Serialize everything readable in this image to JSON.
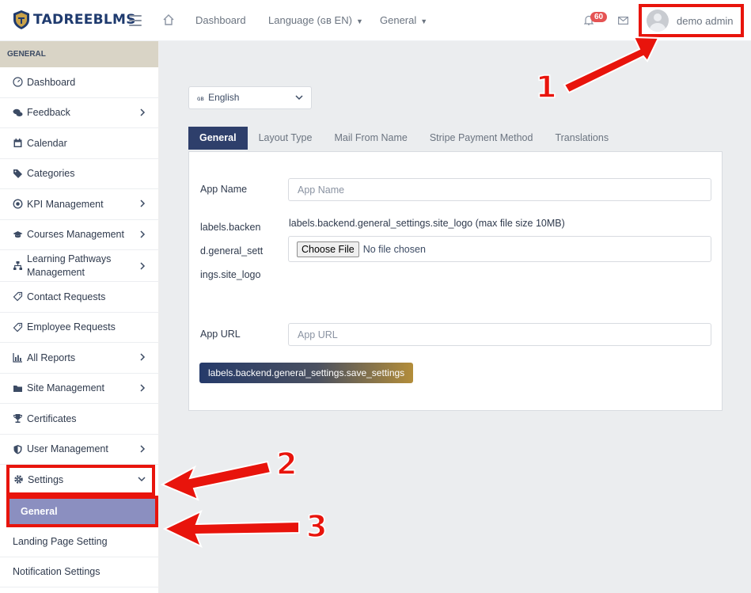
{
  "header": {
    "brand": "TADREEBLMS",
    "nav": [
      {
        "label": "Dashboard",
        "has_caret": false
      },
      {
        "label": "Language (ɢʙ EN)",
        "has_caret": true
      },
      {
        "label": "General",
        "has_caret": true
      }
    ],
    "notification_count": "60",
    "user_name": "demo admin"
  },
  "sidebar": {
    "section_title": "GENERAL",
    "items": [
      {
        "label": "Dashboard",
        "icon": "dashboard-icon"
      },
      {
        "label": "Feedback",
        "icon": "comments-icon",
        "expandable": true
      },
      {
        "label": "Calendar",
        "icon": "calendar-icon"
      },
      {
        "label": "Categories",
        "icon": "tags-icon"
      },
      {
        "label": "KPI Management",
        "icon": "target-icon",
        "expandable": true
      },
      {
        "label": "Courses Management",
        "icon": "graduation-cap-icon",
        "expandable": true
      },
      {
        "label": "Learning Pathways Management",
        "icon": "sitemap-icon",
        "expandable": true
      },
      {
        "label": "Contact Requests",
        "icon": "ticket-icon"
      },
      {
        "label": "Employee Requests",
        "icon": "ticket-icon"
      },
      {
        "label": "All Reports",
        "icon": "bar-chart-icon",
        "expandable": true
      },
      {
        "label": "Site Management",
        "icon": "folder-icon",
        "expandable": true
      },
      {
        "label": "Certificates",
        "icon": "trophy-icon"
      },
      {
        "label": "User Management",
        "icon": "shield-icon",
        "expandable": true
      },
      {
        "label": "Settings",
        "icon": "gear-icon",
        "expanded": true
      }
    ],
    "settings_sub": [
      {
        "label": "General",
        "active": true
      },
      {
        "label": "Landing Page Setting",
        "active": false
      },
      {
        "label": "Notification Settings",
        "active": false
      }
    ]
  },
  "content": {
    "language_select": {
      "flag": "ɢʙ",
      "value": "English"
    },
    "tabs": [
      "General",
      "Layout Type",
      "Mail From Name",
      "Stripe Payment Method",
      "Translations"
    ],
    "form": {
      "app_name_label": "App Name",
      "app_name_placeholder": "App Name",
      "logo_label_lines": [
        "labels.backen",
        "d.general_sett",
        "ings.site_logo"
      ],
      "logo_hint": "labels.backend.general_settings.site_logo (max file size 10MB)",
      "choose_file": "Choose File",
      "no_file": "No file chosen",
      "app_url_label": "App URL",
      "app_url_placeholder": "App URL",
      "save_label": "labels.backend.general_settings.save_settings"
    }
  },
  "annotations": [
    "1",
    "2",
    "3"
  ],
  "colors": {
    "annotation_red": "#e8140c",
    "primary_navy": "#2e3f6b",
    "active_sub": "#8b8fc0",
    "gold": "#b38d3a"
  }
}
